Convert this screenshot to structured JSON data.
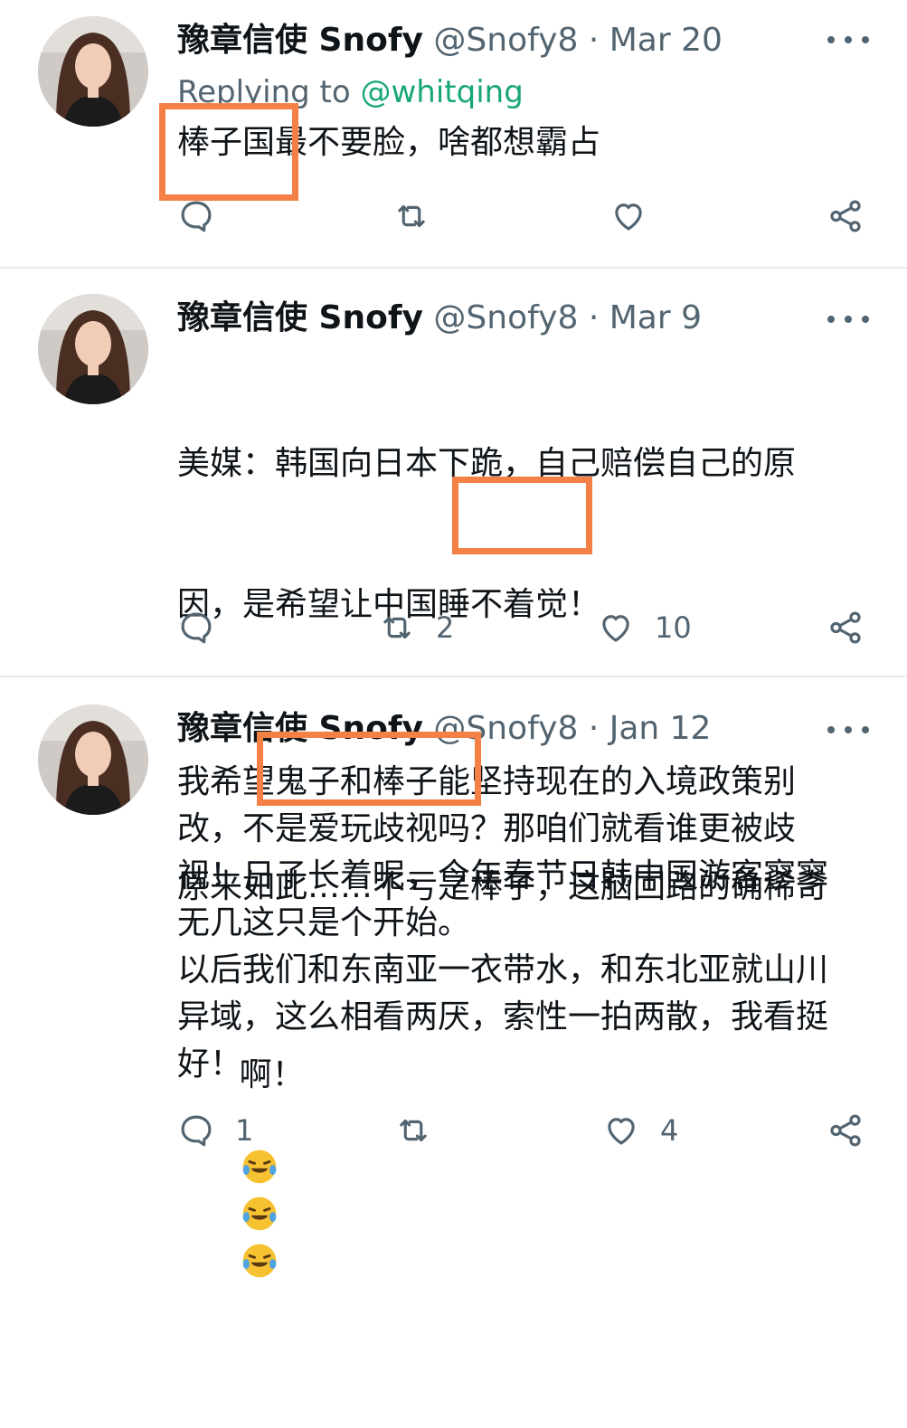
{
  "tweets": [
    {
      "name": "豫章信使 Snofy",
      "handle": "@Snofy8",
      "date": "Mar 20",
      "replying_prefix": "Replying to",
      "replying_to": "@whitqing",
      "text": "棒子国最不要脸，啥都想霸占",
      "reply_count": "",
      "retweet_count": "",
      "like_count": ""
    },
    {
      "name": "豫章信使 Snofy",
      "handle": "@Snofy8",
      "date": "Mar 9",
      "text_line1": "美媒：韩国向日本下跪，自己赔偿自己的原",
      "text_line2": "因，是希望让中国睡不着觉！",
      "text_line3": "原来如此……不亏是棒子，这脑回路的确稀奇",
      "text_line4": "啊！",
      "emoji": "rolling-on-floor-laughing ×3",
      "reply_count": "",
      "retweet_count": "2",
      "like_count": "10"
    },
    {
      "name": "豫章信使 Snofy",
      "handle": "@Snofy8",
      "date": "Jan 12",
      "text": "我希望鬼子和棒子能坚持现在的入境政策别\n改，不是爱玩歧视吗？那咱们就看谁更被歧\n视！日子长着呢，今年春节日韩中国游客寥寥\n无几这只是个开始。\n以后我们和东南亚一衣带水，和东北亚就山川\n异域，这么相看两厌，索性一拍两散，我看挺\n好！",
      "reply_count": "1",
      "retweet_count": "",
      "like_count": "4"
    }
  ],
  "colors": {
    "highlight_box": "#f58046",
    "mention": "#19a67a",
    "secondary_text": "#536471",
    "divider": "#e8ebed"
  },
  "icons": [
    "more-icon",
    "reply-icon",
    "retweet-icon",
    "like-icon",
    "share-icon",
    "laughing-emoji-icon"
  ]
}
